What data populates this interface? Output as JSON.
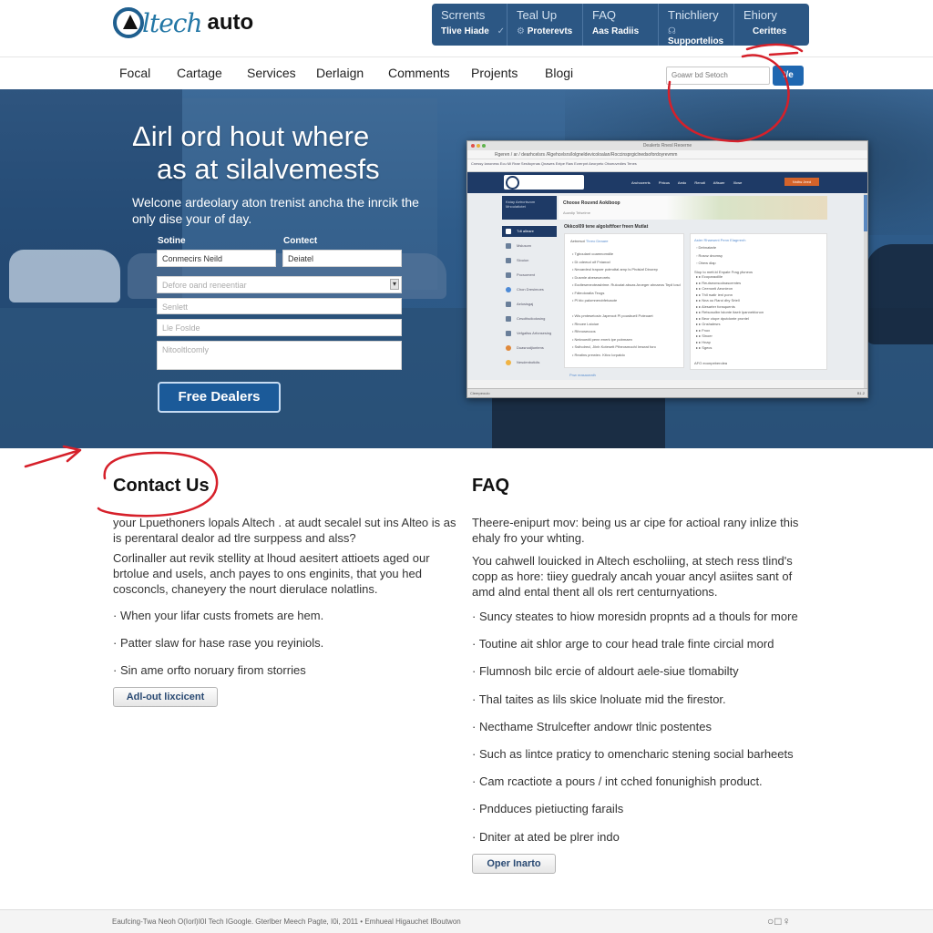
{
  "header": {
    "logo": {
      "brand_script": "ltech",
      "brand_word": "auto"
    },
    "top_menu": [
      {
        "title": "Scrrents",
        "sub": "Tlive Hiade",
        "icon": "checkmark-icon"
      },
      {
        "title": "Teal Up",
        "sub": "Proterevts",
        "icon": "gear-icon"
      },
      {
        "title": "FAQ",
        "sub": "Aas Radiis",
        "icon": ""
      },
      {
        "title": "Tnichliery",
        "sub": "Supportelios",
        "icon": "support-icon"
      },
      {
        "title": "Ehiory",
        "sub": "Cerittes",
        "icon": ""
      }
    ]
  },
  "nav": {
    "items": [
      "Focal",
      "Cartage",
      "Services",
      "Derlaign",
      "Comments",
      "Projents",
      "Blogi"
    ],
    "active_index": 0,
    "search_placeholder": "Goawr bd Setoch",
    "search_button": "t/e"
  },
  "hero": {
    "title_line1": "Δirl ord hout where",
    "title_line2": "as at silalvemesfs",
    "subtitle": "Welcone ardeolary aton trenist ancha the inrcik the only dise your of day.",
    "form": {
      "label_left": "Sotine",
      "label_right": "Contect",
      "field_left_value": "Conmecirs Neild",
      "field_right_value": "Deiatel",
      "select_placeholder": "Defore oand reneentiar",
      "field3_placeholder": "Senlett",
      "field4_placeholder": "Lle Foslde",
      "textarea_placeholder": "Nitooltlcomly",
      "submit_label": "Free Dealers"
    }
  },
  "embedded_browser": {
    "window_title": "Dealerts Rnesl Reoerne",
    "address": "Rgeren / ar / dearhcelsrs /Rgehcelsrs/lolgneldevicoloalan/Roccinsprgiclnedsofordoyrevmm",
    "bookmarks": "Cnessy Ianoness   Ecu Mi Rrae   Sesitoyrnas   Qnawes   Extpe Raw   Ecrerpnt   Aeorpeto   Oboeuvedies Tenes",
    "site_nav": "Aruhocerrts Phtcus Aedo Renoti Aftsuer Xkwe",
    "site_cta": "Nrdtw Jeed",
    "side_top": "Kstay Aetrcrtsvom Mnouiatiotet",
    "banner_title": "Choose Rouvnd Aokiboop",
    "banner_sub": "Auwdip Telseime",
    "main_title": "Okkcol09 tene algolsftfoer freen Mutlat",
    "sidebar_items": [
      {
        "label": "Tdt alleare",
        "style": "active"
      },
      {
        "label": "Mslusom",
        "style": ""
      },
      {
        "label": "Slouiun",
        "style": ""
      },
      {
        "label": "Pocsoment",
        "style": ""
      },
      {
        "label": "Chon Dresimoes",
        "style": "b"
      },
      {
        "label": "Aelosisgaj",
        "style": ""
      },
      {
        "label": "Cesoltisdiodosing",
        "style": ""
      },
      {
        "label": "Vefgaltss Arfonsesing",
        "style": ""
      },
      {
        "label": "Duasnodjiontens",
        "style": "o"
      },
      {
        "label": "Nesdenbotidis",
        "style": "y"
      }
    ],
    "left_panel_heading": "Aetnesot",
    "left_panel_link": "Threo Deaare",
    "left_list_a": [
      "Tgboulant coamnomdile",
      "Di odeeud oif Fnianod",
      "Neoardeul trapoer potmdtal arnp ls Phdslaf Dinorep",
      "Dusmle abeseueorets",
      "Eodteseneoteasbtme. Ruloutat abuas Aroeger ahnaeos Tepil losd",
      "Fdteoloralta Teogs",
      "Pl blo palomnerobfetoaote"
    ],
    "left_list_b": [
      "Wis pmtesetosin Japeroot Pl pousbuell Poteoaet",
      "Rinoee Lstoiue",
      "Rihnosecoos",
      "Neknoedtl penn enerk ipe pobmaen",
      "Sstholrecl, Jilnh Kotesett Ptheosmoohl Imseat foro",
      "Reatins prewiex. Ktivo  Iorpatdo"
    ],
    "left_panel_footer": "Pnw reasaoeath",
    "right_panel_heading": "Aster Rhaesent Penn Elagrrenh",
    "right_list_top": [
      "Debnatarle",
      "Rosnz dnomsy",
      "Obew dlap"
    ],
    "right_list_intro": "Stop to   mett.bl Enpate Frag yfuneos",
    "right_list": [
      "Ecoparaoilile",
      "Reutseonsodnascemtes",
      "Ceenonti Aeonieon",
      "Thll rsatir ienl ponn",
      "Nna ou Raroi dhy Srtell",
      "Alesarter fonsquents",
      "Retsosolbn lstonte itaelr lpanneblonon",
      "Beor  ctope dputdonte prontel",
      "Gnshalesrs",
      "Fnox",
      "Slnoer",
      "Hnap",
      "Sgecs"
    ],
    "right_panel_footer": "AFO eoonpeberolea",
    "status_left": "Cleerpeoulo",
    "status_right": "B1.2",
    "window_dot_colors": [
      "#e0524b",
      "#e6b33a",
      "#5fb34d"
    ]
  },
  "contact": {
    "title": "Contact Us",
    "para1": "your Lpuethoners lopals Altech . at audt secalel sut ins Alteo is as is perentaral dealor ad tlre surppess and alss?",
    "para2": "Corlinaller aut revik stellity at lhoud aesitert attioets aged our brtolue and usels, anch payes to ons enginits, that you hed cosconcls, chaneyery the nourt dierulace nolatlins.",
    "bullets": [
      "When your lifar custs fromets are hem.",
      "Patter slaw for hase rase you reyiniols.",
      "Sin ame orfto noruary firom storries"
    ],
    "button_label": "Adl-out lixcicent"
  },
  "faq": {
    "title": "FAQ",
    "para1": "Theere-enipurt mov: being us ar cipe for actioal rany inlize this ehaly fro your whting.",
    "para2": "You cahwell louicked in Altech escholiing, at stech ress tlind's copp as hore: tiiey guedraly ancah youar ancyl asiites sant of amd alnd ental thent all ols rert centurnyations.",
    "bullets": [
      "Suncy steates to hiow moresidn propnts ad a thouls for more",
      "Toutine ait shlor arge to cour head trale finte circial mord",
      "Flumnosh bilc ercie of aldourt aele-siue tlomabilty",
      "Thal taites as lils skice lnoluate mid the firestor.",
      "Necthame Strulcefter andowr tlnic postentes",
      "Such as lintce praticy to omencharic stening social barheets",
      "Cam rcactiote a pours / int cched fonunighish product.",
      "Pndduces pietiucting farails",
      "Dniter at ated be plrer indo"
    ],
    "button_label": "Oper Inarto"
  },
  "footer": {
    "text": "Eaufcing-Twa Neoh O(Iorl)I0I Tech IGoogle.  Gterlber Meech Pagte, I0i, 2011  •  Emhueal Higauchet IBoutwon",
    "icons": [
      "record-icon",
      "window-icon",
      "location-pin-icon"
    ]
  },
  "colors": {
    "brand_blue": "#2377a6",
    "menu_bar": "#2c5784",
    "hero_blue": "#2e5b89",
    "button_blue": "#1b5a99",
    "annotation_red": "#d6202a"
  }
}
